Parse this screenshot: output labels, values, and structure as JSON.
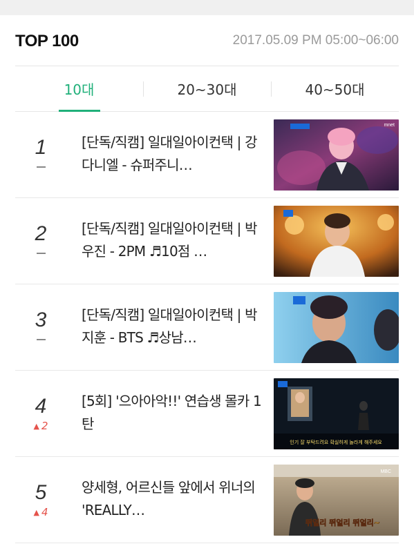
{
  "header": {
    "title": "TOP 100",
    "timestamp": "2017.05.09 PM 05:00~06:00"
  },
  "tabs": [
    {
      "label": "10대",
      "active": true
    },
    {
      "label": "20~30대",
      "active": false
    },
    {
      "label": "40~50대",
      "active": false
    }
  ],
  "items": [
    {
      "rank": "1",
      "change": "",
      "title": "[단독/직캠] 일대일아이컨택 | 강다니엘 - 슈퍼주니…"
    },
    {
      "rank": "2",
      "change": "",
      "title": "[단독/직캠] 일대일아이컨택 | 박우진 - 2PM ♬10점 …"
    },
    {
      "rank": "3",
      "change": "",
      "title": "[단독/직캠] 일대일아이컨택 | 박지훈 - BTS ♬상남…"
    },
    {
      "rank": "4",
      "change": "2",
      "title": "[5회] '으아아악!!' 연습생 몰카 1탄"
    },
    {
      "rank": "5",
      "change": "4",
      "title": "양세형, 어르신들 앞에서 위너의 'REALLY…"
    }
  ],
  "thumbnails": {
    "caption_4": "인기 잘 부탁드려요 확실하게 놀라게 해주세요",
    "caption_5": "뛰얼리 뛰얼리 뛰얼리~",
    "channel_1": "mnet",
    "channel_5": "MBC"
  },
  "colors": {
    "accent": "#20b07a",
    "rank_up": "#e5534b"
  }
}
